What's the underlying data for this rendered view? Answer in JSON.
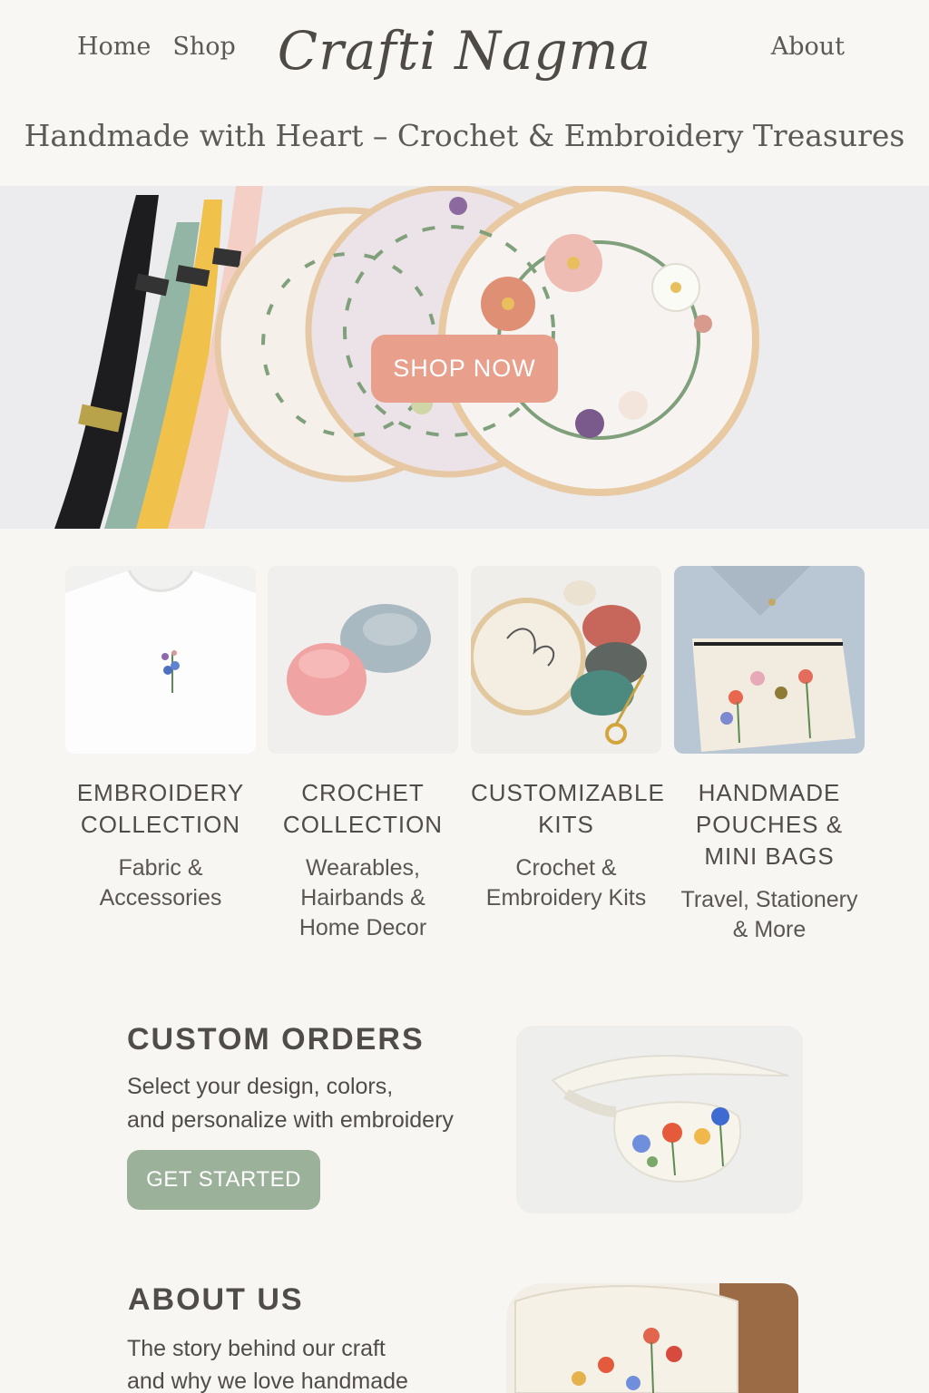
{
  "header": {
    "nav": {
      "home": "Home",
      "shop": "Shop",
      "about": "About"
    },
    "logo": "Crafti Nagma",
    "tagline": "Handmade with Heart – Crochet & Embroidery Treasures"
  },
  "hero": {
    "cta_label": "SHOP NOW",
    "cta_color": "#e8a08c"
  },
  "categories": [
    {
      "title": "EMBROIDERY COLLECTION",
      "subtitle": "Fabric & Accessories"
    },
    {
      "title": "CROCHET COLLECTION",
      "subtitle": "Wearables, Hairbands & Home Decor"
    },
    {
      "title": "CUSTOMIZABLE KITS",
      "subtitle": "Crochet & Embroidery Kits"
    },
    {
      "title": "HANDMADE POUCHES & MINI BAGS",
      "subtitle": "Travel, Stationery & More"
    }
  ],
  "custom_orders": {
    "title": "CUSTOM ORDERS",
    "line1": "Select your design, colors,",
    "line2": "and personalize with embroidery",
    "button_label": "GET STARTED",
    "button_color": "#9bb19a"
  },
  "about": {
    "title": "ABOUT US",
    "line1": "The story behind our craft",
    "line2": "and why we love handmade"
  },
  "colors": {
    "background": "#f8f6f2",
    "text": "#4f4c49"
  }
}
